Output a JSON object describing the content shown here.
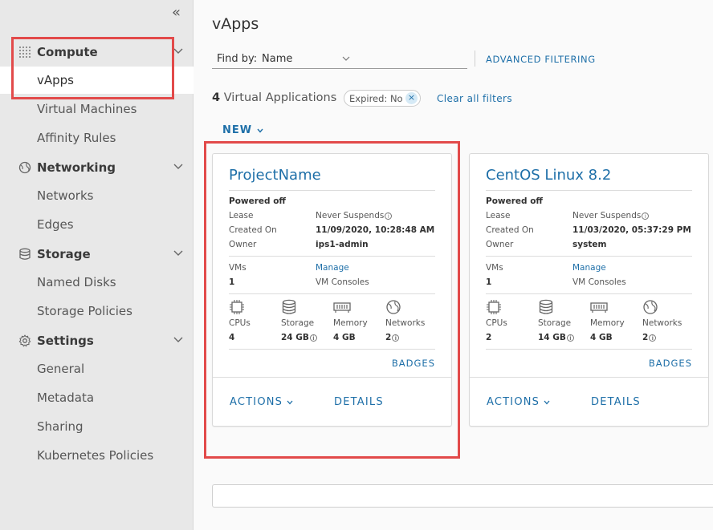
{
  "sidebar": {
    "collapse_glyph": "«",
    "groups": [
      {
        "label": "Compute",
        "icon": "grid-icon",
        "items": [
          "vApps",
          "Virtual Machines",
          "Affinity Rules"
        ]
      },
      {
        "label": "Networking",
        "icon": "globe-icon",
        "items": [
          "Networks",
          "Edges"
        ]
      },
      {
        "label": "Storage",
        "icon": "database-icon",
        "items": [
          "Named Disks",
          "Storage Policies"
        ]
      },
      {
        "label": "Settings",
        "icon": "gear-icon",
        "items": [
          "General",
          "Metadata",
          "Sharing",
          "Kubernetes Policies"
        ]
      }
    ],
    "active_item": "vApps"
  },
  "main": {
    "title": "vApps",
    "find_by": {
      "label": "Find by:",
      "value": "Name"
    },
    "advanced_filtering": "ADVANCED FILTERING",
    "count": "4",
    "count_label": "Virtual Applications",
    "filter_chip": {
      "key": "Expired:",
      "value": "No",
      "remove": "×"
    },
    "clear_filters": "Clear all filters",
    "new_button": "NEW"
  },
  "labels": {
    "powered": "Powered off",
    "lease": "Lease",
    "created_on": "Created On",
    "owner": "Owner",
    "vms": "VMs",
    "manage": "Manage",
    "vm_consoles": "VM Consoles",
    "cpus": "CPUs",
    "storage": "Storage",
    "memory": "Memory",
    "networks": "Networks",
    "badges": "BADGES",
    "actions": "ACTIONS",
    "details": "DETAILS",
    "info_glyph": "i"
  },
  "cards": [
    {
      "name": "ProjectName",
      "lease_value": "Never Suspends",
      "created_value": "11/09/2020, 10:28:48 AM",
      "owner_value": "ips1-admin",
      "vms_value": "1",
      "cpus_value": "4",
      "storage_value": "24 GB",
      "memory_value": "4 GB",
      "networks_value": "2"
    },
    {
      "name": "CentOS Linux 8.2",
      "lease_value": "Never Suspends",
      "created_value": "11/03/2020, 05:37:29 PM",
      "owner_value": "system",
      "vms_value": "1",
      "cpus_value": "2",
      "storage_value": "14 GB",
      "memory_value": "4 GB",
      "networks_value": "2"
    }
  ],
  "colors": {
    "accent": "#1e6fa8",
    "highlight": "#e24a4a",
    "sidebar_bg": "#e8e8e8"
  }
}
